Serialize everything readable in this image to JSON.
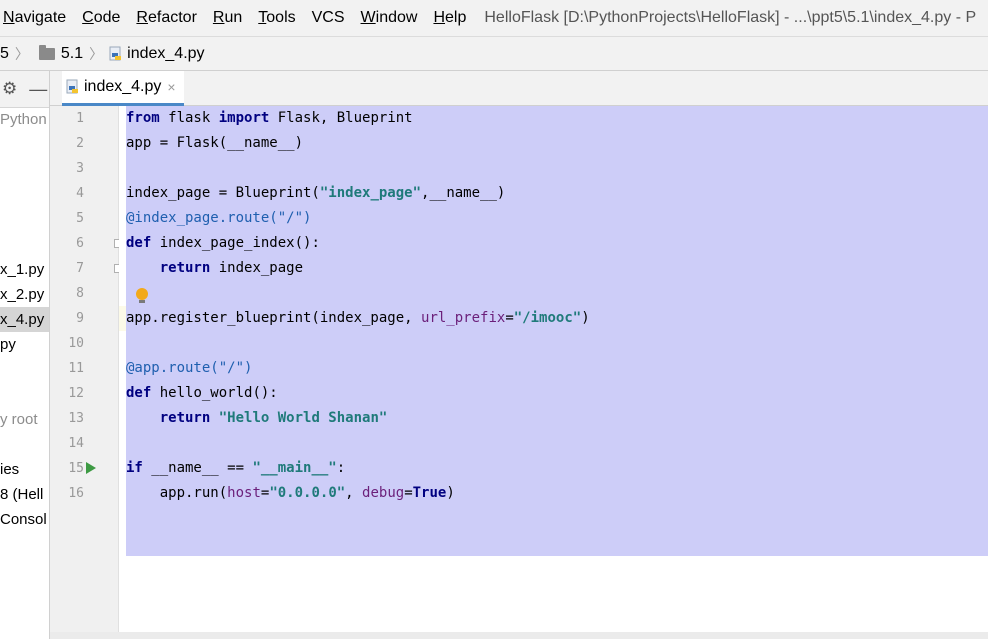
{
  "menu": [
    "Navigate",
    "Code",
    "Refactor",
    "Run",
    "Tools",
    "VCS",
    "Window",
    "Help"
  ],
  "menu_mnemonic": [
    "N",
    "C",
    "R",
    "R",
    "T",
    "",
    "W",
    "H"
  ],
  "window_title": "HelloFlask [D:\\PythonProjects\\HelloFlask] - ...\\ppt5\\5.1\\index_4.py - P",
  "breadcrumb": {
    "part1": "5",
    "part2": "5.1",
    "file": "index_4.py"
  },
  "project_panel": {
    "items": [
      {
        "label": "Python",
        "muted": true
      },
      {
        "label": "x_1.py"
      },
      {
        "label": "x_2.py"
      },
      {
        "label": "x_4.py",
        "selected": true
      },
      {
        "label": "py"
      },
      {
        "label": "y root",
        "muted": true
      },
      {
        "label": "ies"
      },
      {
        "label": "8 (Hell"
      },
      {
        "label": "Consol"
      }
    ]
  },
  "tab": {
    "label": "index_4.py",
    "close": "×"
  },
  "line_numbers": [
    "1",
    "2",
    "3",
    "4",
    "5",
    "6",
    "7",
    "8",
    "9",
    "10",
    "11",
    "12",
    "13",
    "14",
    "15",
    "16"
  ],
  "code": {
    "l1": {
      "a": "from",
      "b": " flask ",
      "c": "import",
      "d": " Flask, Blueprint"
    },
    "l2": "app = Flask(__name__)",
    "l4": {
      "a": "index_page = Blueprint(",
      "b": "\"index_page\"",
      "c": ",__name__)"
    },
    "l5": "@index_page.route(\"/\")",
    "l6": {
      "a": "def",
      "b": " index_page_index():"
    },
    "l7": {
      "a": "    ",
      "b": "return",
      "c": " index_page"
    },
    "l9": {
      "a": "app.register_blueprint(index_page, ",
      "b": "url_prefix",
      "c": "=",
      "d": "\"/imooc\"",
      "e": ")"
    },
    "l11": "@app.route(\"/\")",
    "l12": {
      "a": "def",
      "b": " hello_world():"
    },
    "l13": {
      "a": "    ",
      "b": "return",
      "c": " ",
      "d": "\"Hello World Shanan\""
    },
    "l15": {
      "a": "if",
      "b": " __name__ == ",
      "c": "\"__main__\"",
      "d": ":"
    },
    "l16": {
      "a": "    app.run(",
      "b": "host",
      "c": "=",
      "d": "\"0.0.0.0\"",
      "e": ", ",
      "f": "debug",
      "g": "=",
      "h": "True",
      "i": ")"
    }
  },
  "colors": {
    "selection": "#cdcdf8",
    "keyword": "#000080",
    "string": "#1f7a7a",
    "caret_row": "#fcfae8"
  }
}
